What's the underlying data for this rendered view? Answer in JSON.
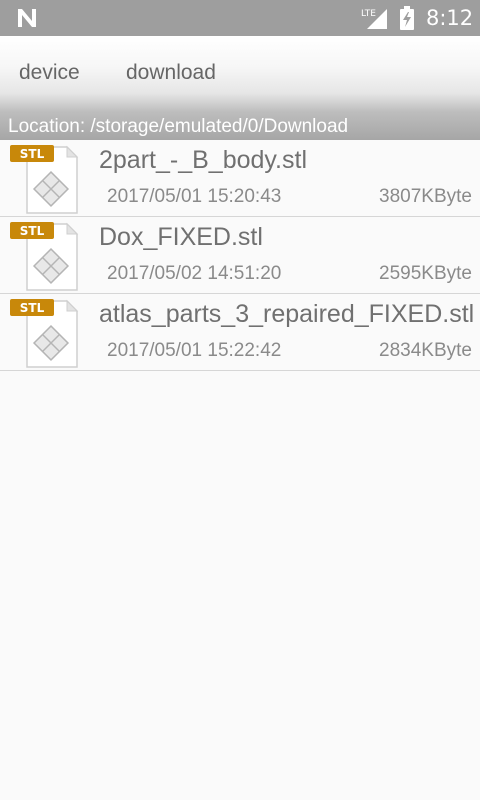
{
  "status_bar": {
    "network_label": "LTE",
    "time": "8:12",
    "icons": [
      "n-logo-icon",
      "lte-signal-icon",
      "battery-charging-icon"
    ],
    "background_color": "#9e9e9e"
  },
  "toolbar": {
    "tabs": [
      {
        "label": "device"
      },
      {
        "label": "download"
      }
    ]
  },
  "location": {
    "text": "Location: /storage/emulated/0/Download"
  },
  "files": [
    {
      "icon_label": "STL",
      "name": "2part_-_B_body.stl",
      "date": "2017/05/01 15:20:43",
      "size": "3807KByte"
    },
    {
      "icon_label": "STL",
      "name": "Dox_FIXED.stl",
      "date": "2017/05/02 14:51:20",
      "size": "2595KByte"
    },
    {
      "icon_label": "STL",
      "name": "atlas_parts_3_repaired_FIXED.stl",
      "date": "2017/05/01 15:22:42",
      "size": "2834KByte"
    }
  ],
  "colors": {
    "stl_badge": "#c8880a",
    "text_primary": "#707070",
    "text_secondary": "#8a8a8a"
  }
}
